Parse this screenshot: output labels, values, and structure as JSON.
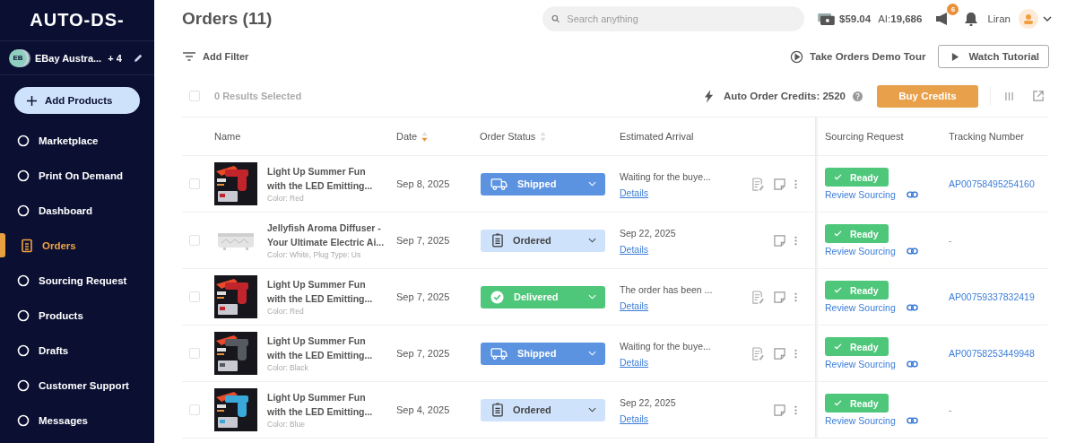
{
  "sidebar": {
    "logo": "AUTO-DS-",
    "account": {
      "initials": "EB",
      "name": "EBay Austra...",
      "extra": "+ 4"
    },
    "add_button": "Add Products",
    "items": [
      {
        "label": "Marketplace",
        "selected": false
      },
      {
        "label": "Print On Demand",
        "selected": false
      },
      {
        "label": "Dashboard",
        "selected": false
      },
      {
        "label": "Orders",
        "selected": true
      },
      {
        "label": "Sourcing Request",
        "selected": false
      },
      {
        "label": "Products",
        "selected": false
      },
      {
        "label": "Drafts",
        "selected": false
      },
      {
        "label": "Customer Support",
        "selected": false
      },
      {
        "label": "Messages",
        "selected": false
      }
    ]
  },
  "header": {
    "title": "Orders (11)",
    "search": {
      "placeholder": "Search anything"
    },
    "balance": "$59.04",
    "ai_label": "AI:",
    "ai_value": "19,686",
    "notifications": "6",
    "user": "Liran"
  },
  "toolbar": {
    "filter": "Add Filter",
    "demo_tour": "Take Orders Demo Tour",
    "tutorial": "Watch Tutorial",
    "select_all": {
      "checked": false
    },
    "selected_count": "0 Results Selected",
    "credits": "Auto Order Credits: 2520",
    "buy": "Buy Credits"
  },
  "table": {
    "columns": [
      "Name",
      "Date",
      "Order Status",
      "Estimated Arrival",
      "Sourcing Request",
      "Tracking Number"
    ],
    "rows": [
      {
        "checked": false,
        "title1": "Light Up Summer Fun",
        "title2": "with the LED Emitting...",
        "variant": "Color: Red",
        "date": "Sep 8, 2025",
        "status": {
          "kind": "shipped",
          "label": "Shipped"
        },
        "arrival": "Waiting for the buye...",
        "details": "Details",
        "invoice_icon": true,
        "sourcing": "Ready",
        "review": "Review Sourcing",
        "tracking": "AP00758495254160"
      },
      {
        "checked": false,
        "title1": "Jellyfish Aroma Diffuser -",
        "title2": "Your Ultimate Electric Ai...",
        "variant": "Color: White, Plug Type: Us",
        "date": "Sep 7, 2025",
        "status": {
          "kind": "ordered",
          "label": "Ordered"
        },
        "arrival": "Sep 22, 2025",
        "details": "Details",
        "invoice_icon": false,
        "sourcing": "Ready",
        "review": "Review Sourcing",
        "tracking": "-"
      },
      {
        "checked": false,
        "title1": "Light Up Summer Fun",
        "title2": "with the LED Emitting...",
        "variant": "Color: Red",
        "date": "Sep 7, 2025",
        "status": {
          "kind": "delivered",
          "label": "Delivered"
        },
        "arrival": "The order has been ...",
        "details": "Details",
        "invoice_icon": true,
        "sourcing": "Ready",
        "review": "Review Sourcing",
        "tracking": "AP00759337832419"
      },
      {
        "checked": false,
        "title1": "Light Up Summer Fun",
        "title2": "with the LED Emitting...",
        "variant": "Color: Black",
        "date": "Sep 7, 2025",
        "status": {
          "kind": "shipped",
          "label": "Shipped"
        },
        "arrival": "Waiting for the buye...",
        "details": "Details",
        "invoice_icon": true,
        "sourcing": "Ready",
        "review": "Review Sourcing",
        "tracking": "AP00758253449948"
      },
      {
        "checked": false,
        "title1": "Light Up Summer Fun",
        "title2": "with the LED Emitting...",
        "variant": "Color: Blue",
        "date": "Sep 4, 2025",
        "status": {
          "kind": "ordered",
          "label": "Ordered"
        },
        "arrival": "Sep 22, 2025",
        "details": "Details",
        "invoice_icon": false,
        "sourcing": "Ready",
        "review": "Review Sourcing",
        "tracking": "-"
      }
    ]
  }
}
